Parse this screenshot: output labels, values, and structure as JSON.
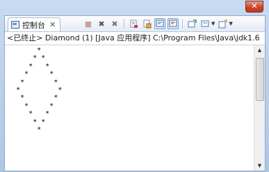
{
  "window": {
    "close_glyph": "✕"
  },
  "tab": {
    "label": "控制台",
    "close_glyph": "✕"
  },
  "toolbar": {
    "icons": [
      "terminate-icon",
      "remove-launch-icon",
      "remove-all-terminated-icon",
      "clear-console-icon",
      "scroll-lock-icon",
      "show-on-stdout-icon",
      "show-on-stderr-icon",
      "pin-console-icon",
      "display-selected-console-icon",
      "open-console-icon"
    ]
  },
  "path_label": "<已终止> Diamond (1) [Java 应用程序] C:\\Program Files\\Java\\jdk1.6",
  "console": {
    "lines": [
      "      *",
      "     * *",
      "    *   *",
      "   *     *",
      "  *       *",
      " *         *",
      "  *       *",
      "   *     *",
      "    *   *",
      "     * *",
      "      *"
    ]
  },
  "colors": {
    "frame": "#aec6e6",
    "close_button": "#c8462c",
    "accent": "#2c5aa0"
  }
}
